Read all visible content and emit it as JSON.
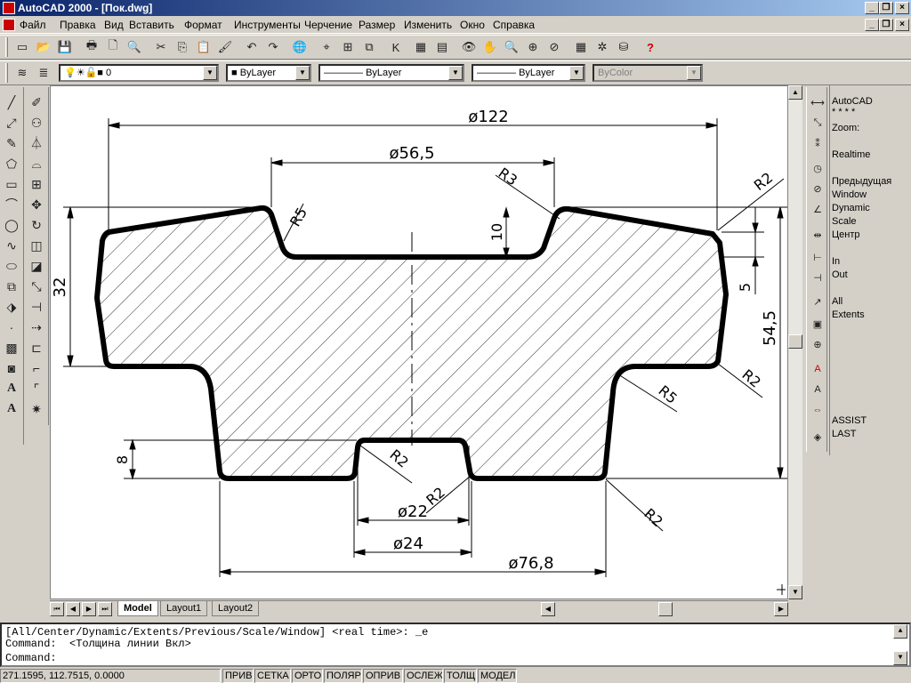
{
  "window": {
    "title": "AutoCAD 2000 - [Пок.dwg]"
  },
  "menu": [
    "Файл",
    "Правка",
    "Вид",
    "Вставить",
    "Формат",
    "Инструменты",
    "Черчение",
    "Размер",
    "Изменить",
    "Окно",
    "Справка"
  ],
  "properties": {
    "layer": "0",
    "color": "ByLayer",
    "linetype": "ByLayer",
    "lineweight": "ByLayer",
    "plotstyle": "ByColor"
  },
  "dimensions": {
    "d122": "ø122",
    "d56": "ø56,5",
    "d22": "ø22",
    "d24": "ø24",
    "d768": "ø76,8",
    "h32": "32",
    "h10": "10",
    "h5": "5",
    "h545": "54,5",
    "h8": "8",
    "r5a": "R5",
    "r3": "R3",
    "r2a": "R2",
    "r5b": "R5",
    "r2b": "R2",
    "r2c": "R2",
    "r2d": "R2",
    "r2e": "R2"
  },
  "right_menu": [
    "AutoCAD",
    "* * * *",
    "Zoom:",
    "Realtime",
    "Предыдущая",
    "Window",
    "Dynamic",
    "Scale",
    "Центр",
    "In",
    "Out",
    "All",
    "Extents",
    "ASSIST",
    "LAST"
  ],
  "tabs": [
    "Model",
    "Layout1",
    "Layout2"
  ],
  "command": {
    "line1": "[All/Center/Dynamic/Extents/Previous/Scale/Window] <real time>: _e",
    "line2": "Command:  <Толщина линии Вкл>",
    "line3": "Command:"
  },
  "status": {
    "coords": "271.1595, 112.7515, 0.0000",
    "modes": [
      "ПРИВ",
      "СЕТКА",
      "ОРТО",
      "ПОЛЯР",
      "ОПРИВ",
      "ОСЛЕЖ",
      "ТОЛЩ",
      "МОДЕЛ"
    ]
  },
  "colors": {
    "title_start": "#0a246a",
    "title_end": "#a6caf0",
    "face": "#d4d0c8"
  }
}
